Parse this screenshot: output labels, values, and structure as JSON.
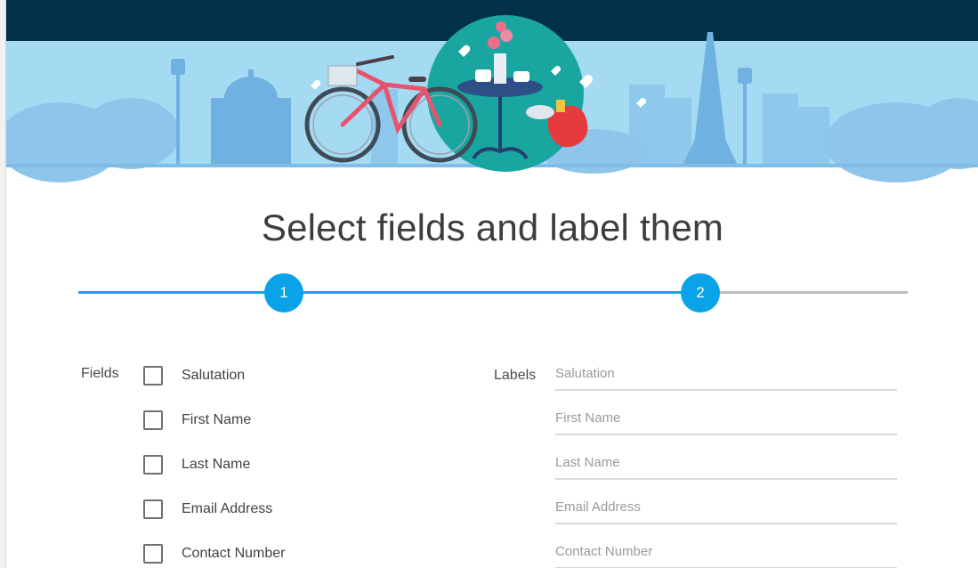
{
  "page": {
    "title": "Select fields and label them"
  },
  "stepper": {
    "steps": [
      "1",
      "2"
    ],
    "active_step": 2,
    "progress_color": "#14a6e6",
    "inactive_color": "#bdbdbd",
    "step_color": "#0aa2e8"
  },
  "fields": {
    "heading": "Fields",
    "items": [
      {
        "label": "Salutation",
        "checked": false
      },
      {
        "label": "First Name",
        "checked": false
      },
      {
        "label": "Last Name",
        "checked": false
      },
      {
        "label": "Email Address",
        "checked": false
      },
      {
        "label": "Contact Number",
        "checked": false
      }
    ]
  },
  "labels": {
    "heading": "Labels",
    "inputs": [
      {
        "value": "",
        "placeholder": "Salutation"
      },
      {
        "value": "",
        "placeholder": "First Name"
      },
      {
        "value": "",
        "placeholder": "Last Name"
      },
      {
        "value": "",
        "placeholder": "Email Address"
      },
      {
        "value": "",
        "placeholder": "Contact Number"
      }
    ]
  },
  "hero": {
    "top_bar_color": "#003149",
    "sky_color": "#a5dbf2",
    "illustration": "paris-bicycle-cafe-illustration"
  }
}
